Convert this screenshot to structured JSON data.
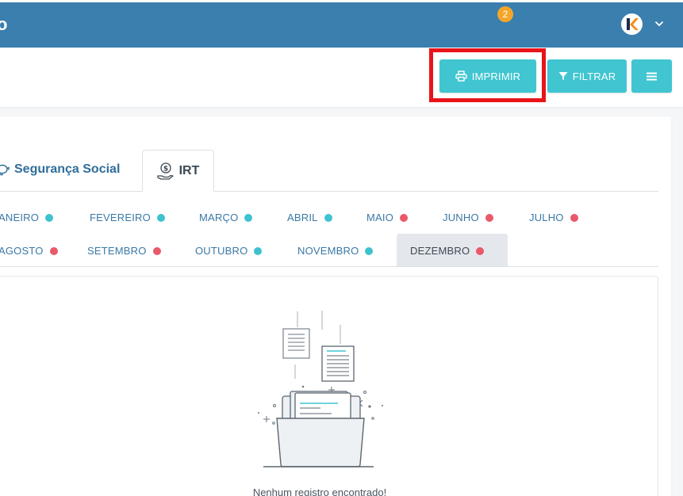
{
  "topbar": {
    "brand": "o",
    "notifications_count": "2",
    "icons": [
      "bell-icon",
      "gear-icon",
      "help-icon",
      "avatar",
      "chevron-down-icon"
    ],
    "color": "#3a7fae"
  },
  "actions": {
    "print_label": "IMPRIMIR",
    "filter_label": "FILTRAR",
    "accent": "#40c5d1",
    "highlight_color": "#e8141a"
  },
  "tabs": [
    {
      "label": "Segurança Social",
      "icon": "piggy-bank-icon"
    },
    {
      "label": "IRT",
      "icon": "money-hand-icon"
    }
  ],
  "months": [
    {
      "label": "ANEIRO",
      "status": "ok"
    },
    {
      "label": "FEVEREIRO",
      "status": "ok"
    },
    {
      "label": "MARÇO",
      "status": "ok"
    },
    {
      "label": "ABRIL",
      "status": "ok"
    },
    {
      "label": "MAIO",
      "status": "pending"
    },
    {
      "label": "JUNHO",
      "status": "pending"
    },
    {
      "label": "JULHO",
      "status": "pending"
    },
    {
      "label": "AGOSTO",
      "status": "pending"
    },
    {
      "label": "SETEMBRO",
      "status": "pending"
    },
    {
      "label": "OUTUBRO",
      "status": "ok"
    },
    {
      "label": "NOVEMBRO",
      "status": "ok"
    },
    {
      "label": "DEZEMBRO",
      "status": "pending"
    }
  ],
  "selected_month": "DEZEMBRO",
  "status_colors": {
    "ok": "#3fc2cf",
    "pending": "#e8596a"
  },
  "empty_state": {
    "text": "Nenhum registro encontrado!"
  }
}
